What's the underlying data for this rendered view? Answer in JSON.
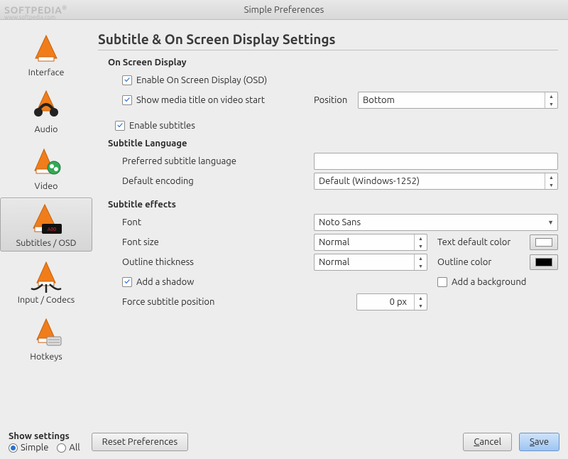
{
  "window": {
    "title": "Simple Preferences"
  },
  "watermark": {
    "brand": "SOFTPEDIA",
    "sub": "www.softpedia.com"
  },
  "sidebar": {
    "items": [
      {
        "label": "Interface"
      },
      {
        "label": "Audio"
      },
      {
        "label": "Video"
      },
      {
        "label": "Subtitles / OSD"
      },
      {
        "label": "Input / Codecs"
      },
      {
        "label": "Hotkeys"
      }
    ]
  },
  "page": {
    "title": "Subtitle & On Screen Display Settings",
    "osd": {
      "section": "On Screen Display",
      "enable_osd": "Enable On Screen Display (OSD)",
      "show_title": "Show media title on video start",
      "position_label": "Position",
      "position_value": "Bottom"
    },
    "enable_subtitles": "Enable subtitles",
    "lang": {
      "section": "Subtitle Language",
      "preferred_label": "Preferred subtitle language",
      "preferred_value": "",
      "encoding_label": "Default encoding",
      "encoding_value": "Default (Windows-1252)"
    },
    "effects": {
      "section": "Subtitle effects",
      "font_label": "Font",
      "font_value": "Noto Sans",
      "fontsize_label": "Font size",
      "fontsize_value": "Normal",
      "textcolor_label": "Text default color",
      "textcolor_value": "#ffffff",
      "outline_thickness_label": "Outline thickness",
      "outline_thickness_value": "Normal",
      "outline_color_label": "Outline color",
      "outline_color_value": "#000000",
      "add_shadow": "Add a shadow",
      "add_background": "Add a background",
      "force_pos_label": "Force subtitle position",
      "force_pos_value": "0 px"
    }
  },
  "footer": {
    "show_settings": "Show settings",
    "simple": "Simple",
    "all": "All",
    "reset": "Reset Preferences",
    "cancel": "Cancel",
    "cancel_key": "C",
    "save": "Save",
    "save_key": "S"
  }
}
